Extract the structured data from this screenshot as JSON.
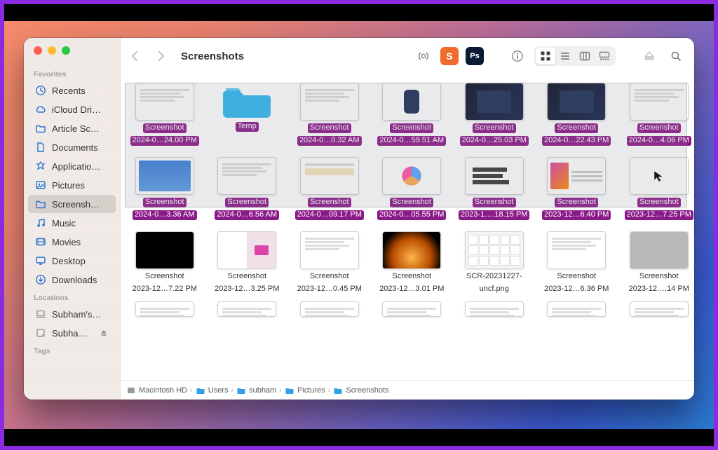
{
  "window": {
    "title": "Screenshots"
  },
  "sidebar": {
    "sections": [
      {
        "label": "Favorites",
        "items": [
          {
            "icon": "clock",
            "label": "Recents"
          },
          {
            "icon": "cloud",
            "label": "iCloud Dri…"
          },
          {
            "icon": "folder",
            "label": "Article Sc…"
          },
          {
            "icon": "doc",
            "label": "Documents"
          },
          {
            "icon": "app",
            "label": "Applicatio…"
          },
          {
            "icon": "picture",
            "label": "Pictures"
          },
          {
            "icon": "folder",
            "label": "Screensh…",
            "active": true
          },
          {
            "icon": "music",
            "label": "Music"
          },
          {
            "icon": "movie",
            "label": "Movies"
          },
          {
            "icon": "desktop",
            "label": "Desktop"
          },
          {
            "icon": "download",
            "label": "Downloads"
          }
        ]
      },
      {
        "label": "Locations",
        "items": [
          {
            "icon": "laptop",
            "label": "Subham's…",
            "gray": true
          },
          {
            "icon": "disk",
            "label": "Subha…",
            "gray": true,
            "eject": true
          }
        ]
      },
      {
        "label": "Tags",
        "items": []
      }
    ]
  },
  "toolbar_apps": [
    "S",
    "Ps"
  ],
  "items_row1": [
    {
      "line1": "Screenshot",
      "line2": "2024-0…24.00 PM",
      "sel": true,
      "art": "doc"
    },
    {
      "line1": "Temp",
      "line2": "",
      "sel": true,
      "art": "folder"
    },
    {
      "line1": "Screenshot",
      "line2": "2024-0…0.32 AM",
      "sel": true,
      "art": "doc"
    },
    {
      "line1": "Screenshot",
      "line2": "2024-0…59.51 AM",
      "sel": true,
      "art": "watch"
    },
    {
      "line1": "Screenshot",
      "line2": "2024-0…25.03 PM",
      "sel": true,
      "art": "dark"
    },
    {
      "line1": "Screenshot",
      "line2": "2024-0…22.43 PM",
      "sel": true,
      "art": "dark"
    },
    {
      "line1": "Screenshot",
      "line2": "2024-0…4.06 PM",
      "sel": true,
      "art": "doc"
    }
  ],
  "items_row2": [
    {
      "line1": "Screenshot",
      "line2": "2024-0…3.36 AM",
      "sel": true,
      "art": "blue"
    },
    {
      "line1": "Screenshot",
      "line2": "2024-0…6.56 AM",
      "sel": true,
      "art": "doc"
    },
    {
      "line1": "Screenshot",
      "line2": "2024-0…09.17 PM",
      "sel": true,
      "art": "text"
    },
    {
      "line1": "Screenshot",
      "line2": "2024-0…05.55 PM",
      "sel": true,
      "art": "pie"
    },
    {
      "line1": "Screenshot",
      "line2": "2023-1….18.15 PM",
      "sel": true,
      "art": "bars"
    },
    {
      "line1": "Screenshot",
      "line2": "2023-12…6.40 PM",
      "sel": true,
      "art": "face"
    },
    {
      "line1": "Screenshot",
      "line2": "2023-12…7.25 PM",
      "sel": true,
      "art": "cursor"
    }
  ],
  "items_row3": [
    {
      "line1": "Screenshot",
      "line2": "2023-12…7.22 PM",
      "sel": false,
      "art": "black"
    },
    {
      "line1": "Screenshot",
      "line2": "2023-12…3.25 PM",
      "sel": false,
      "art": "split"
    },
    {
      "line1": "Screenshot",
      "line2": "2023-12…0.45 PM",
      "sel": false,
      "art": "doc"
    },
    {
      "line1": "Screenshot",
      "line2": "2023-12…3.01 PM",
      "sel": false,
      "art": "fire"
    },
    {
      "line1": "SCR-20231227-",
      "line2": "uncf.png",
      "sel": false,
      "art": "keys"
    },
    {
      "line1": "Screenshot",
      "line2": "2023-12…6.36 PM",
      "sel": false,
      "art": "doc"
    },
    {
      "line1": "Screenshot",
      "line2": "2023-12….14 PM",
      "sel": false,
      "art": "gray"
    }
  ],
  "path": [
    "Macintosh HD",
    "Users",
    "subham",
    "Pictures",
    "Screenshots"
  ]
}
